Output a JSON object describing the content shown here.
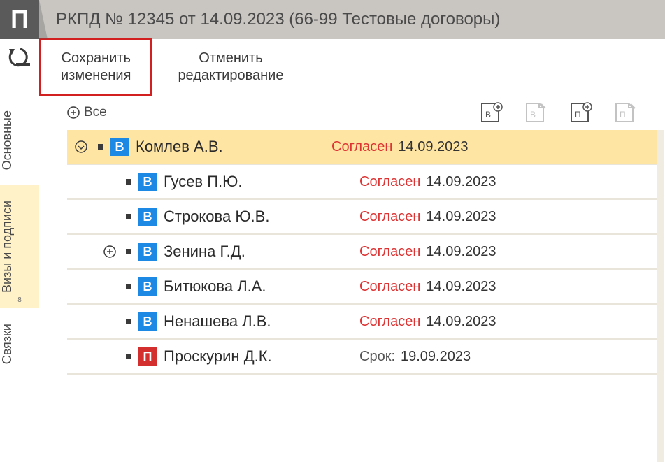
{
  "header": {
    "logo_letter": "П",
    "title": "РКПД №  12345 от 14.09.2023 (66-99 Тестовые договоры)"
  },
  "toolbar": {
    "save_line1": "Сохранить",
    "save_line2": "изменения",
    "cancel_line1": "Отменить",
    "cancel_line2": "редактирование"
  },
  "side_tabs": {
    "t0": "Основные",
    "t1": "Визы и подписи",
    "t1_badge": "8",
    "t2": "Связки"
  },
  "list_header": {
    "all_label": "Все"
  },
  "rows": [
    {
      "type_letter": "В",
      "type_class": "b",
      "name": "Комлев А.В.",
      "status": "Согласен",
      "date": "14.09.2023",
      "selected": true,
      "expand": "down"
    },
    {
      "type_letter": "В",
      "type_class": "b",
      "name": "Гусев П.Ю.",
      "status": "Согласен",
      "date": "14.09.2023",
      "selected": false,
      "expand": "none"
    },
    {
      "type_letter": "В",
      "type_class": "b",
      "name": "Строкова Ю.В.",
      "status": "Согласен",
      "date": "14.09.2023",
      "selected": false,
      "expand": "none"
    },
    {
      "type_letter": "В",
      "type_class": "b",
      "name": "Зенина Г.Д.",
      "status": "Согласен",
      "date": "14.09.2023",
      "selected": false,
      "expand": "plus"
    },
    {
      "type_letter": "В",
      "type_class": "b",
      "name": "Битюкова Л.А.",
      "status": "Согласен",
      "date": "14.09.2023",
      "selected": false,
      "expand": "none"
    },
    {
      "type_letter": "В",
      "type_class": "b",
      "name": "Ненашева Л.В.",
      "status": "Согласен",
      "date": "14.09.2023",
      "selected": false,
      "expand": "none"
    },
    {
      "type_letter": "П",
      "type_class": "p",
      "name": "Проскурин Д.К.",
      "status": "Срок:",
      "date": "19.09.2023",
      "selected": false,
      "expand": "none",
      "muted": true
    }
  ]
}
